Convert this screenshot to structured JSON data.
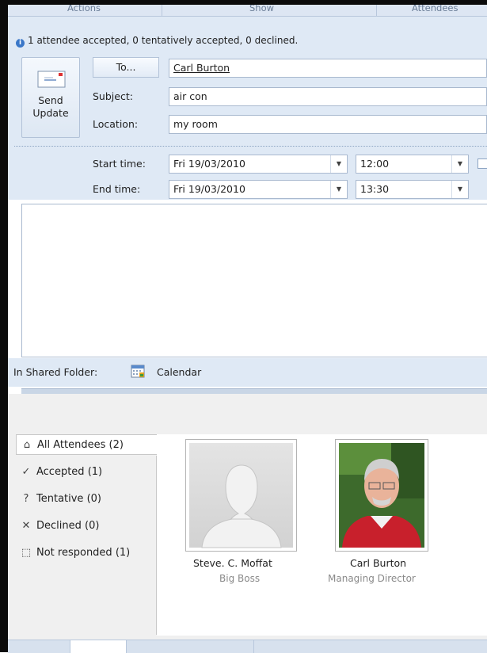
{
  "ribbon_groups": [
    "Actions",
    "Show",
    "Attendees"
  ],
  "info_message": "1 attendee accepted, 0 tentatively accepted, 0 declined.",
  "send_update": {
    "line1": "Send",
    "line2": "Update"
  },
  "to_button": "To...",
  "fields": {
    "to_value": "Carl Burton",
    "subject_label": "Subject:",
    "subject_value": "air con",
    "location_label": "Location:",
    "location_value": "my room"
  },
  "times": {
    "start_label": "Start time:",
    "start_date": "Fri 19/03/2010",
    "start_time": "12:00",
    "end_label": "End time:",
    "end_date": "Fri 19/03/2010",
    "end_time": "13:30"
  },
  "shared_folder": {
    "label": "In Shared Folder:",
    "folder": "Calendar"
  },
  "filters": [
    {
      "icon": "home-icon",
      "glyph": "⌂",
      "label": "All Attendees (2)"
    },
    {
      "icon": "check-icon",
      "glyph": "✓",
      "label": "Accepted (1)"
    },
    {
      "icon": "question-icon",
      "glyph": "?",
      "label": "Tentative (0)"
    },
    {
      "icon": "cross-icon",
      "glyph": "✕",
      "label": "Declined (0)"
    },
    {
      "icon": "dotted-box-icon",
      "glyph": "⬚",
      "label": "Not responded (1)"
    }
  ],
  "attendees": [
    {
      "name": "Steve. C. Moffat",
      "role": "Big Boss"
    },
    {
      "name": "Carl Burton",
      "role": "Managing Director"
    }
  ],
  "colors": {
    "accent": "#3a77c8",
    "pane": "#dfe9f5",
    "photo_bg_red": "#c8202c"
  }
}
